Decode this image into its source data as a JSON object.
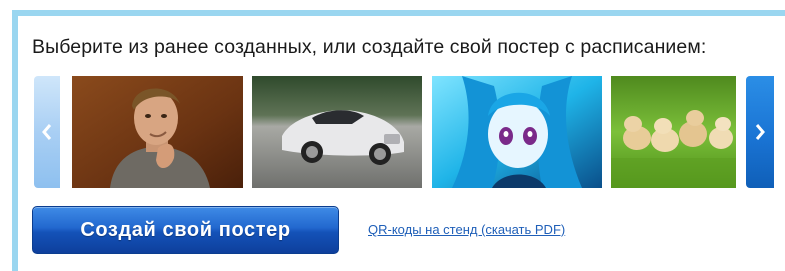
{
  "heading": "Выберите из ранее созданных, или создайте свой постер с расписанием:",
  "carousel": {
    "prev_icon": "chevron-left-icon",
    "next_icon": "chevron-right-icon",
    "thumbnails": [
      {
        "name": "poster-thumbnail-man"
      },
      {
        "name": "poster-thumbnail-car"
      },
      {
        "name": "poster-thumbnail-anime"
      },
      {
        "name": "poster-thumbnail-puppies"
      }
    ]
  },
  "cta_button": "Создай свой постер",
  "qr_link": "QR-коды на стенд (скачать PDF)",
  "colors": {
    "frame_border": "#9ad6f0",
    "button": "#1a5fc4",
    "link": "#1f5fb8"
  }
}
